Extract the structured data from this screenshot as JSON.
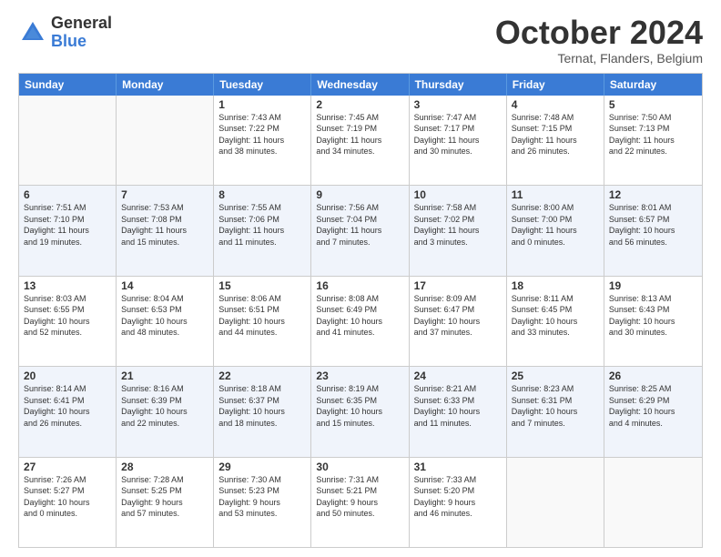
{
  "logo": {
    "general": "General",
    "blue": "Blue"
  },
  "title": "October 2024",
  "subtitle": "Ternat, Flanders, Belgium",
  "days": [
    "Sunday",
    "Monday",
    "Tuesday",
    "Wednesday",
    "Thursday",
    "Friday",
    "Saturday"
  ],
  "rows": [
    [
      {
        "day": "",
        "info": ""
      },
      {
        "day": "",
        "info": ""
      },
      {
        "day": "1",
        "info": "Sunrise: 7:43 AM\nSunset: 7:22 PM\nDaylight: 11 hours\nand 38 minutes."
      },
      {
        "day": "2",
        "info": "Sunrise: 7:45 AM\nSunset: 7:19 PM\nDaylight: 11 hours\nand 34 minutes."
      },
      {
        "day": "3",
        "info": "Sunrise: 7:47 AM\nSunset: 7:17 PM\nDaylight: 11 hours\nand 30 minutes."
      },
      {
        "day": "4",
        "info": "Sunrise: 7:48 AM\nSunset: 7:15 PM\nDaylight: 11 hours\nand 26 minutes."
      },
      {
        "day": "5",
        "info": "Sunrise: 7:50 AM\nSunset: 7:13 PM\nDaylight: 11 hours\nand 22 minutes."
      }
    ],
    [
      {
        "day": "6",
        "info": "Sunrise: 7:51 AM\nSunset: 7:10 PM\nDaylight: 11 hours\nand 19 minutes."
      },
      {
        "day": "7",
        "info": "Sunrise: 7:53 AM\nSunset: 7:08 PM\nDaylight: 11 hours\nand 15 minutes."
      },
      {
        "day": "8",
        "info": "Sunrise: 7:55 AM\nSunset: 7:06 PM\nDaylight: 11 hours\nand 11 minutes."
      },
      {
        "day": "9",
        "info": "Sunrise: 7:56 AM\nSunset: 7:04 PM\nDaylight: 11 hours\nand 7 minutes."
      },
      {
        "day": "10",
        "info": "Sunrise: 7:58 AM\nSunset: 7:02 PM\nDaylight: 11 hours\nand 3 minutes."
      },
      {
        "day": "11",
        "info": "Sunrise: 8:00 AM\nSunset: 7:00 PM\nDaylight: 11 hours\nand 0 minutes."
      },
      {
        "day": "12",
        "info": "Sunrise: 8:01 AM\nSunset: 6:57 PM\nDaylight: 10 hours\nand 56 minutes."
      }
    ],
    [
      {
        "day": "13",
        "info": "Sunrise: 8:03 AM\nSunset: 6:55 PM\nDaylight: 10 hours\nand 52 minutes."
      },
      {
        "day": "14",
        "info": "Sunrise: 8:04 AM\nSunset: 6:53 PM\nDaylight: 10 hours\nand 48 minutes."
      },
      {
        "day": "15",
        "info": "Sunrise: 8:06 AM\nSunset: 6:51 PM\nDaylight: 10 hours\nand 44 minutes."
      },
      {
        "day": "16",
        "info": "Sunrise: 8:08 AM\nSunset: 6:49 PM\nDaylight: 10 hours\nand 41 minutes."
      },
      {
        "day": "17",
        "info": "Sunrise: 8:09 AM\nSunset: 6:47 PM\nDaylight: 10 hours\nand 37 minutes."
      },
      {
        "day": "18",
        "info": "Sunrise: 8:11 AM\nSunset: 6:45 PM\nDaylight: 10 hours\nand 33 minutes."
      },
      {
        "day": "19",
        "info": "Sunrise: 8:13 AM\nSunset: 6:43 PM\nDaylight: 10 hours\nand 30 minutes."
      }
    ],
    [
      {
        "day": "20",
        "info": "Sunrise: 8:14 AM\nSunset: 6:41 PM\nDaylight: 10 hours\nand 26 minutes."
      },
      {
        "day": "21",
        "info": "Sunrise: 8:16 AM\nSunset: 6:39 PM\nDaylight: 10 hours\nand 22 minutes."
      },
      {
        "day": "22",
        "info": "Sunrise: 8:18 AM\nSunset: 6:37 PM\nDaylight: 10 hours\nand 18 minutes."
      },
      {
        "day": "23",
        "info": "Sunrise: 8:19 AM\nSunset: 6:35 PM\nDaylight: 10 hours\nand 15 minutes."
      },
      {
        "day": "24",
        "info": "Sunrise: 8:21 AM\nSunset: 6:33 PM\nDaylight: 10 hours\nand 11 minutes."
      },
      {
        "day": "25",
        "info": "Sunrise: 8:23 AM\nSunset: 6:31 PM\nDaylight: 10 hours\nand 7 minutes."
      },
      {
        "day": "26",
        "info": "Sunrise: 8:25 AM\nSunset: 6:29 PM\nDaylight: 10 hours\nand 4 minutes."
      }
    ],
    [
      {
        "day": "27",
        "info": "Sunrise: 7:26 AM\nSunset: 5:27 PM\nDaylight: 10 hours\nand 0 minutes."
      },
      {
        "day": "28",
        "info": "Sunrise: 7:28 AM\nSunset: 5:25 PM\nDaylight: 9 hours\nand 57 minutes."
      },
      {
        "day": "29",
        "info": "Sunrise: 7:30 AM\nSunset: 5:23 PM\nDaylight: 9 hours\nand 53 minutes."
      },
      {
        "day": "30",
        "info": "Sunrise: 7:31 AM\nSunset: 5:21 PM\nDaylight: 9 hours\nand 50 minutes."
      },
      {
        "day": "31",
        "info": "Sunrise: 7:33 AM\nSunset: 5:20 PM\nDaylight: 9 hours\nand 46 minutes."
      },
      {
        "day": "",
        "info": ""
      },
      {
        "day": "",
        "info": ""
      }
    ]
  ]
}
